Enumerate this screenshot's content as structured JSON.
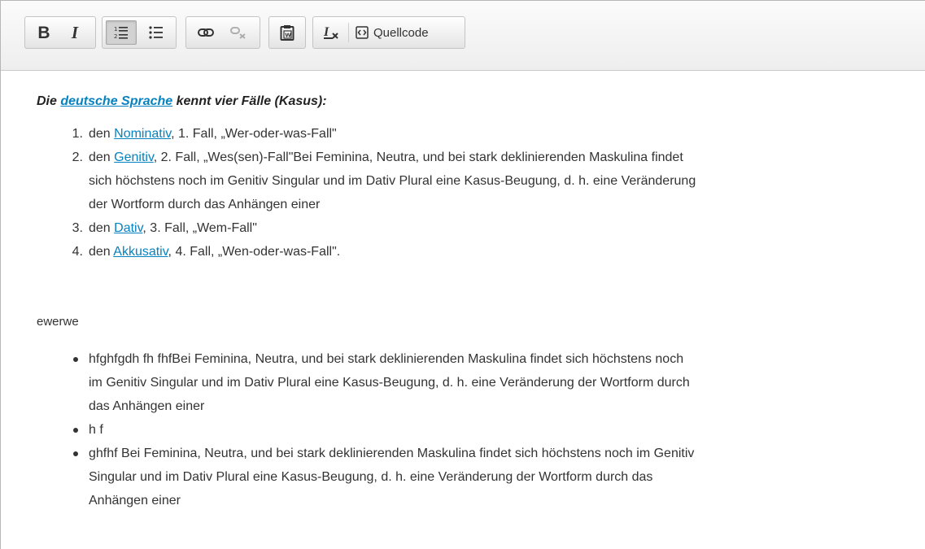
{
  "toolbar": {
    "bold_label": "B",
    "italic_label": "I",
    "source_label": "Quellcode"
  },
  "content": {
    "heading": {
      "prefix": "Die ",
      "link": "deutsche Sprache",
      "suffix": " kennt vier Fälle (Kasus):"
    },
    "ordered_list": [
      {
        "number": "1.",
        "pre": "den ",
        "link": "Nominativ",
        "lines": [
          ", 1. Fall, „Wer-oder-was-Fall\""
        ]
      },
      {
        "number": "2.",
        "pre": "den ",
        "link": "Genitiv",
        "lines": [
          ", 2. Fall, „Wes(sen)-Fall\"Bei Feminina, Neutra, und bei stark deklinierenden Maskulina findet",
          "sich höchstens noch im Genitiv Singular und im Dativ Plural eine Kasus-Beugung, d. h. eine Veränderung",
          "der Wortform durch das Anhängen einer"
        ]
      },
      {
        "number": "3.",
        "pre": "den ",
        "link": "Dativ",
        "lines": [
          ", 3. Fall, „Wem-Fall\""
        ]
      },
      {
        "number": "4.",
        "pre": "den ",
        "link": "Akkusativ",
        "lines": [
          ", 4. Fall, „Wen-oder-was-Fall\"."
        ]
      }
    ],
    "paragraph": "ewerwe",
    "bullet_list": [
      {
        "lines": [
          "hfghfgdh fh fhfBei Feminina, Neutra, und bei stark deklinierenden Maskulina findet sich höchstens noch",
          "im Genitiv Singular und im Dativ Plural eine Kasus-Beugung, d. h. eine Veränderung der Wortform durch",
          "das Anhängen einer"
        ]
      },
      {
        "lines": [
          "h f"
        ]
      },
      {
        "lines": [
          "ghfhf Bei Feminina, Neutra, und bei stark deklinierenden Maskulina findet sich höchstens noch im Genitiv",
          "Singular und im Dativ Plural eine Kasus-Beugung, d. h. eine Veränderung der Wortform durch das",
          "Anhängen einer"
        ]
      }
    ]
  }
}
